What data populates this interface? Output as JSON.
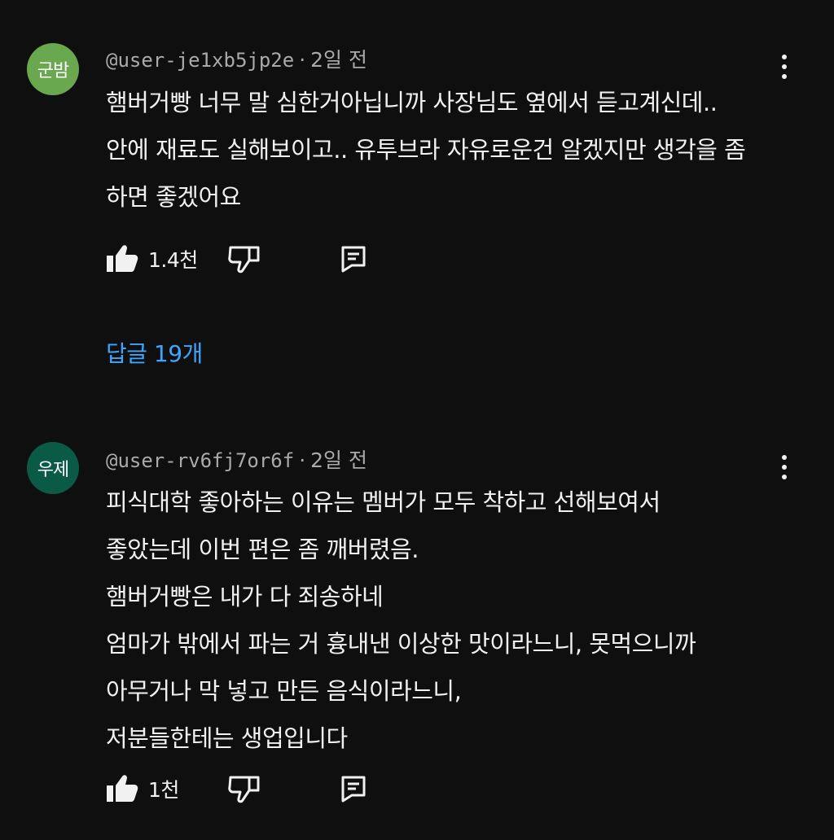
{
  "colors": {
    "background": "#0f0f0f",
    "text": "#f1f1f1",
    "muted": "#aaaaaa",
    "link": "#3ea6ff"
  },
  "comments": [
    {
      "avatar_text": "군밤",
      "avatar_color": "#6aa84f",
      "handle": "@user-je1xb5jp2e",
      "separator": "·",
      "time": "2일 전",
      "lines": [
        "햄버거빵 너무 말 심한거아닙니까 사장님도 옆에서 듣고계신데..",
        "안에 재료도 실해보이고.. 유투브라 자유로운건 알겠지만 생각을 좀",
        "하면 좋겠어요"
      ],
      "like_count": "1.4천",
      "replies_label": "답글 19개",
      "icons": [
        "like-icon",
        "dislike-icon",
        "reply-icon",
        "more-vert-icon"
      ]
    },
    {
      "avatar_text": "우제",
      "avatar_color": "#0b5a45",
      "handle": "@user-rv6fj7or6f",
      "separator": "·",
      "time": "2일 전",
      "lines": [
        "피식대학 좋아하는 이유는 멤버가 모두 착하고 선해보여서",
        "좋았는데 이번 편은 좀 깨버렸음.",
        "햄버거빵은 내가 다 죄송하네",
        "엄마가 밖에서 파는 거 흉내낸 이상한 맛이라느니, 못먹으니까",
        "아무거나 막 넣고 만든 음식이라느니,",
        "저분들한테는 생업입니다"
      ],
      "like_count": "1천",
      "icons": [
        "like-icon",
        "dislike-icon",
        "reply-icon",
        "more-vert-icon"
      ]
    }
  ]
}
